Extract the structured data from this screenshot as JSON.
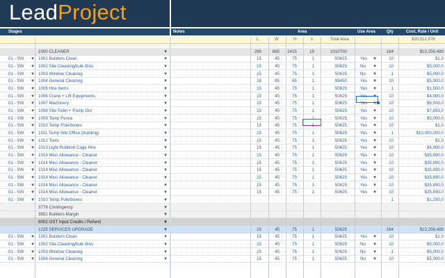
{
  "app": {
    "logo_part1": "Lead",
    "logo_part2": "Project"
  },
  "headers": {
    "stages": "Stages",
    "notes": "Notes",
    "area": "Area",
    "use_area": "Use Area",
    "qty": "Qty",
    "cost": "Cost, Rate / Unit"
  },
  "totals_row": {
    "L": "L",
    "W": "W",
    "H": "H",
    "x": "x",
    "total_area": "Total Area",
    "grand_total": "$20,512,978"
  },
  "rows": [
    {
      "kind": "group",
      "stage": "",
      "item": "1000 CLEANER",
      "L": "288",
      "W": "895",
      "H": "1415",
      "x": "19",
      "area": "1010700",
      "use": "",
      "qty": "164",
      "cost": "$10,256,489"
    },
    {
      "kind": "plain",
      "stage": "01 - SW",
      "item": "1001 Builders Clean",
      "L": "15",
      "W": "45",
      "H": "75",
      "x": "1",
      "area": "50625",
      "use": "Yes",
      "qty": "10",
      "cost": "$1,0"
    },
    {
      "kind": "plain",
      "stage": "01 - SW",
      "item": "1002 Site Cleaning/bulk Bins",
      "L": "15",
      "W": "45",
      "H": "75",
      "x": "1",
      "area": "50625",
      "use": "No",
      "qty": "10",
      "cost": "$5,000,0"
    },
    {
      "kind": "plain",
      "stage": "01 - SW",
      "item": "1003 Window Cleaning",
      "L": "15",
      "W": "45",
      "H": "75",
      "x": "1",
      "area": "50625",
      "use": "No",
      "qty": "1",
      "cost": "$5,000,0"
    },
    {
      "kind": "plain",
      "stage": "01 - SW",
      "item": "1004 General Cleaning",
      "L": "18",
      "W": "85",
      "H": "65",
      "x": "1",
      "area": "99450",
      "use": "Yes",
      "qty": "10",
      "cost": "$5,000,0"
    },
    {
      "kind": "plain",
      "stage": "01 - SW",
      "item": "1005 Hire Items",
      "L": "15",
      "W": "45",
      "H": "75",
      "x": "1",
      "area": "50625",
      "use": "Yes",
      "qty": "1",
      "cost": "$1,500,0"
    },
    {
      "kind": "plain",
      "stage": "01 - SW",
      "item": "1006 Crane + Lift Equipments",
      "L": "15",
      "W": "45",
      "H": "75",
      "x": "1",
      "area": "50625",
      "use": "Yes",
      "qty": "10",
      "cost": "$4,900,0"
    },
    {
      "kind": "plain",
      "stage": "01 - SW",
      "item": "1007 Machinery",
      "L": "15",
      "W": "45",
      "H": "75",
      "x": "1",
      "area": "50625",
      "use": "Yes",
      "qty": "10",
      "cost": "$6,500,0"
    },
    {
      "kind": "plain",
      "stage": "01 - SW",
      "item": "1008 Site Toilet + Pump Out",
      "L": "15",
      "W": "45",
      "H": "75",
      "x": "1",
      "area": "50625",
      "use": "Yes",
      "qty": "10",
      "cost": "$7,893,0"
    },
    {
      "kind": "plain",
      "stage": "01 - SW",
      "item": "1009 Temp Fence",
      "L": "15",
      "W": "45",
      "H": "75",
      "x": "1",
      "area": "50625",
      "use": "Yes",
      "qty": "10",
      "cost": "$5,000,0"
    },
    {
      "kind": "plain",
      "stage": "01 - SW",
      "item": "1010 Temp Pole/boxes",
      "L": "15",
      "W": "45",
      "H": "75",
      "x": "1",
      "area": "50625",
      "use": "Yes",
      "qty": "10",
      "cost": "$1,0"
    },
    {
      "kind": "plain",
      "stage": "01 - SW",
      "item": "1011 Temp Site Office (building)",
      "L": "15",
      "W": "45",
      "H": "75",
      "x": "1",
      "area": "50625",
      "use": "Yes",
      "qty": "1",
      "cost": "$10,000,000,0"
    },
    {
      "kind": "plain",
      "stage": "01 - SW",
      "item": "1012 Tools",
      "L": "15",
      "W": "45",
      "H": "75",
      "x": "1",
      "area": "50625",
      "use": "Yes",
      "qty": "10",
      "cost": "$1,0"
    },
    {
      "kind": "plain",
      "stage": "01 - SW",
      "item": "1013 Light Rubbish Cage Hire",
      "L": "15",
      "W": "45",
      "H": "75",
      "x": "1",
      "area": "50625",
      "use": "Yes",
      "qty": "10",
      "cost": "$4,900,0"
    },
    {
      "kind": "plain",
      "stage": "01 - SW",
      "item": "1014 Misc Allowance - Cleaner",
      "L": "15",
      "W": "45",
      "H": "75",
      "x": "1",
      "area": "50625",
      "use": "Yes",
      "qty": "10",
      "cost": "$35,890,0"
    },
    {
      "kind": "plain",
      "stage": "01 - SW",
      "item": "1014 Misc Allowance - Cleaner",
      "L": "15",
      "W": "45",
      "H": "75",
      "x": "1",
      "area": "50625",
      "use": "Yes",
      "qty": "10",
      "cost": "$35,890,0"
    },
    {
      "kind": "plain",
      "stage": "01 - SW",
      "item": "1014 Misc Allowance - Cleaner",
      "L": "15",
      "W": "45",
      "H": "75",
      "x": "1",
      "area": "50625",
      "use": "Yes",
      "qty": "10",
      "cost": "$35,890,0"
    },
    {
      "kind": "plain",
      "stage": "01 - SW",
      "item": "1014 Misc Allowance - Cleaner",
      "L": "15",
      "W": "45",
      "H": "75",
      "x": "1",
      "area": "50625",
      "use": "Yes",
      "qty": "10",
      "cost": "$35,890,0"
    },
    {
      "kind": "plain",
      "stage": "01 - SW",
      "item": "1014 Misc Allowance - Cleaner",
      "L": "15",
      "W": "45",
      "H": "75",
      "x": "1",
      "area": "50625",
      "use": "Yes",
      "qty": "10",
      "cost": "$35,890,0"
    },
    {
      "kind": "plain",
      "stage": "01 - SW",
      "item": "1014 Misc Allowance - Cleaner",
      "L": "15",
      "W": "45",
      "H": "75",
      "x": "1",
      "area": "50625",
      "use": "Yes",
      "qty": "10",
      "cost": "$35,890,0"
    },
    {
      "kind": "plain",
      "stage": "01 - SW",
      "item": "1010 Temp Pole/boxes",
      "L": "",
      "W": "",
      "H": "",
      "x": "",
      "area": "",
      "use": "",
      "qty": "1",
      "cost": "$1,250,0"
    },
    {
      "kind": "misc",
      "stage": "",
      "item": "3776 Contingency",
      "L": "",
      "W": "",
      "H": "",
      "x": "",
      "area": "",
      "use": "",
      "qty": "",
      "cost": ""
    },
    {
      "kind": "misc",
      "stage": "",
      "item": "3851 Builders Margin",
      "L": "",
      "W": "",
      "H": "",
      "x": "",
      "area": "",
      "use": "",
      "qty": "",
      "cost": ""
    },
    {
      "kind": "gst",
      "stage": "",
      "item": "6002 GST Input Credits / Refund",
      "L": "",
      "W": "",
      "H": "",
      "x": "",
      "area": "",
      "use": "",
      "qty": "",
      "cost": ""
    },
    {
      "kind": "alt-cat",
      "stage": "",
      "item": "1225 SERVICES UPGRADE",
      "L": "15",
      "W": "45",
      "H": "75",
      "x": "1",
      "area": "50625",
      "use": "",
      "qty": "164",
      "cost": "$10,256,489"
    },
    {
      "kind": "plain",
      "stage": "01 - SW",
      "item": "1001 Builders Clean",
      "L": "15",
      "W": "45",
      "H": "75",
      "x": "1",
      "area": "50625",
      "use": "Yes",
      "qty": "10",
      "cost": "$1,0"
    },
    {
      "kind": "plain",
      "stage": "01 - SW",
      "item": "1002 Site Cleaning/bulk Bins",
      "L": "15",
      "W": "45",
      "H": "75",
      "x": "1",
      "area": "50625",
      "use": "No",
      "qty": "10",
      "cost": "$5,000,0"
    },
    {
      "kind": "plain",
      "stage": "01 - SW",
      "item": "1003 Window Cleaning",
      "L": "15",
      "W": "45",
      "H": "75",
      "x": "1",
      "area": "50625",
      "use": "No",
      "qty": "1",
      "cost": "$5,000,0"
    },
    {
      "kind": "plain",
      "stage": "01 - SW",
      "item": "1004 General Cleaning",
      "L": "15",
      "W": "45",
      "H": "75",
      "x": "1",
      "area": "50625",
      "use": "No",
      "qty": "10",
      "cost": "$5,000,0"
    }
  ]
}
